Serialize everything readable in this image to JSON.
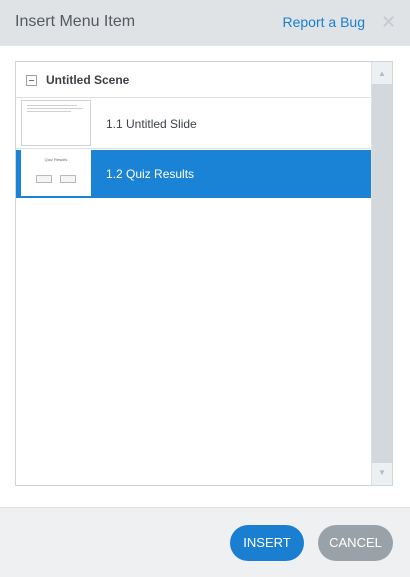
{
  "dialog": {
    "title": "Insert Menu Item",
    "report_link": "Report a Bug",
    "close_icon": "close-icon"
  },
  "tree": {
    "scene": {
      "label": "Untitled Scene",
      "expanded": true
    },
    "slides": [
      {
        "label": "1.1 Untitled Slide",
        "selected": false
      },
      {
        "label": "1.2 Quiz Results",
        "selected": true,
        "thumb_title": "Quiz Results"
      }
    ]
  },
  "buttons": {
    "insert": "INSERT",
    "cancel": "CANCEL"
  },
  "colors": {
    "accent": "#1a7fd0",
    "selection": "#1a83d6",
    "cancel": "#9aa2a9"
  }
}
